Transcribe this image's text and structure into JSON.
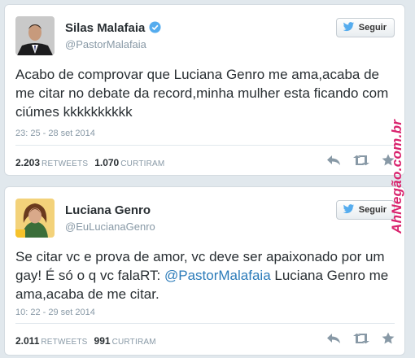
{
  "colors": {
    "background": "#e1e8ed",
    "link": "#2b7bb9",
    "verified": "#55acee",
    "watermark": "#d9246e"
  },
  "tweets": [
    {
      "name": "Silas Malafaia",
      "verified": true,
      "handle": "@PastorMalafaia",
      "follow_label": "Seguir",
      "text": "Acabo de comprovar que Luciana Genro me ama,acaba de me citar no debate da record,minha mulher esta ficando com ciúmes  kkkkkkkkkk",
      "timestamp": "23: 25 - 28 set 2014",
      "retweets": "2.203",
      "retweets_label": "RETWEETS",
      "likes": "1.070",
      "likes_label": "CURTIRAM",
      "icons": [
        "reply-icon",
        "retweet-icon",
        "favorite-icon"
      ]
    },
    {
      "name": "Luciana Genro",
      "verified": false,
      "handle": "@EuLucianaGenro",
      "follow_label": "Seguir",
      "text_before": "Se citar vc e prova de amor, vc deve ser apaixonado por um gay! É só o q vc falaRT: ",
      "mention": "@PastorMalafaia",
      "text_after": " Luciana Genro me ama,acaba de me citar.",
      "timestamp": "10: 22 - 29 set 2014",
      "retweets": "2.011",
      "retweets_label": "RETWEETS",
      "likes": "991",
      "likes_label": "CURTIRAM",
      "icons": [
        "reply-icon",
        "retweet-icon",
        "favorite-icon"
      ]
    }
  ],
  "watermark": "AhNegão.com.br"
}
